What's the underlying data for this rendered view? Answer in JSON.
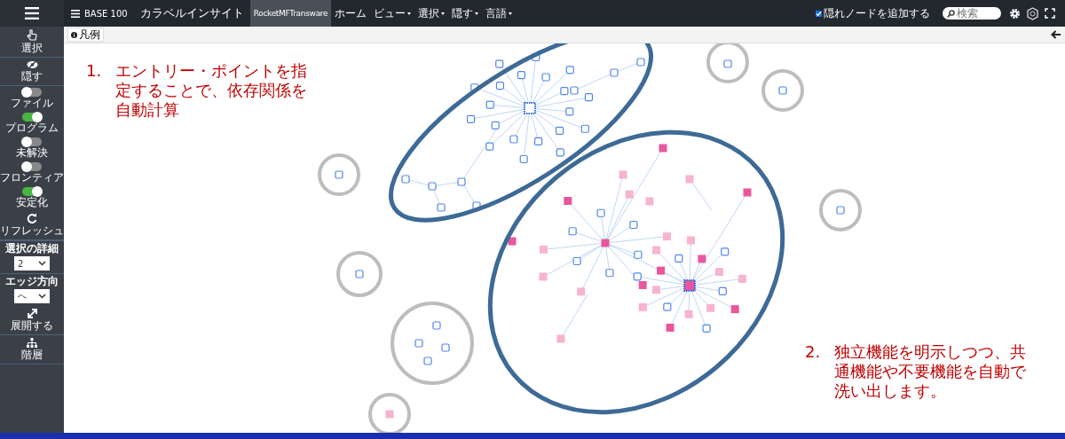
{
  "topbar": {
    "brand": "BASE 100",
    "app_title": "カラベルインサイト",
    "project": "RocketMFTransware",
    "menus": [
      {
        "label": "ホーム",
        "dropdown": false
      },
      {
        "label": "ビュー",
        "dropdown": true
      },
      {
        "label": "選択",
        "dropdown": true
      },
      {
        "label": "隠す",
        "dropdown": true
      },
      {
        "label": "言語",
        "dropdown": true
      }
    ],
    "hidden_nodes": {
      "label": "隠れノードを追加する",
      "checked": true
    },
    "search": {
      "placeholder": "検索"
    }
  },
  "sidebar": [
    {
      "kind": "tool",
      "label": "選択"
    },
    {
      "kind": "tool",
      "label": "隠す"
    },
    {
      "kind": "toggle",
      "label": "ファイル",
      "on": false
    },
    {
      "kind": "toggle",
      "label": "プログラム",
      "on": true
    },
    {
      "kind": "toggle",
      "label": "未解決",
      "on": false
    },
    {
      "kind": "toggle",
      "label": "フロンティア",
      "on": false
    },
    {
      "kind": "toggle",
      "label": "安定化",
      "on": true
    },
    {
      "kind": "tool",
      "label": "リフレッシュ"
    },
    {
      "kind": "select",
      "label": "選択の詳細",
      "value": "2"
    },
    {
      "kind": "select",
      "label": "エッジ方向",
      "value": "へ"
    },
    {
      "kind": "tool",
      "label": "展開する"
    },
    {
      "kind": "tool",
      "label": "階層"
    }
  ],
  "legend_tab": {
    "label": "凡例"
  },
  "annotations": [
    {
      "number": "1.",
      "text": "エントリー・ポイントを指定することで、依存関係を自動計算"
    },
    {
      "number": "2.",
      "text": "独立機能を明示しつつ、共通機能や不要機能を自動で洗い出します。"
    }
  ]
}
